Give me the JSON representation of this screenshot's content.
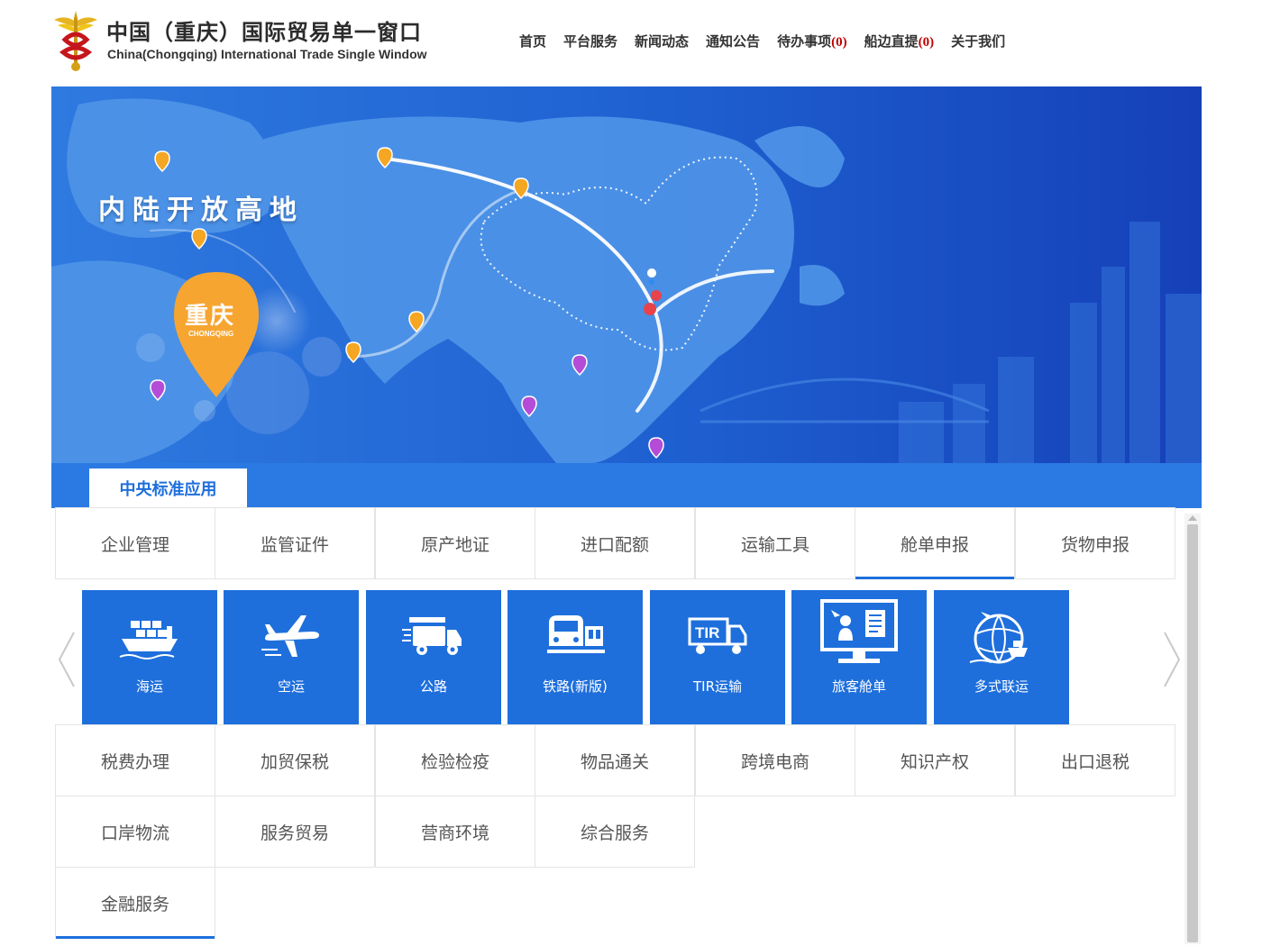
{
  "header": {
    "title_cn": "中国（重庆）国际贸易单一窗口",
    "title_en": "China(Chongqing) International Trade Single Window",
    "nav": [
      {
        "label": "首页"
      },
      {
        "label": "平台服务"
      },
      {
        "label": "新闻动态"
      },
      {
        "label": "通知公告"
      },
      {
        "label": "待办事项",
        "count": "(0)"
      },
      {
        "label": "船边直提",
        "count": "(0)"
      },
      {
        "label": "关于我们"
      }
    ]
  },
  "banner": {
    "slogan": "内陆开放高地",
    "city_cn": "重庆",
    "city_en": "CHONGQING"
  },
  "section_tab": "中央标准应用",
  "grid_rows": [
    [
      "企业管理",
      "监管证件",
      "原产地证",
      "进口配额",
      "运输工具",
      "舱单申报",
      "货物申报"
    ],
    [
      "税费办理",
      "加贸保税",
      "检验检疫",
      "物品通关",
      "跨境电商",
      "知识产权",
      "出口退税"
    ],
    [
      "口岸物流",
      "服务贸易",
      "营商环境",
      "综合服务"
    ],
    [
      "金融服务"
    ]
  ],
  "active_category": "舱单申报",
  "sub_tiles": [
    {
      "label": "海运",
      "icon": "ship-icon"
    },
    {
      "label": "空运",
      "icon": "airplane-icon"
    },
    {
      "label": "公路",
      "icon": "truck-icon"
    },
    {
      "label": "铁路(新版)",
      "icon": "train-icon"
    },
    {
      "label": "TIR运输",
      "icon": "tir-truck-icon",
      "icon_text": "TIR"
    },
    {
      "label": "旅客舱单",
      "icon": "passenger-monitor-icon"
    },
    {
      "label": "多式联运",
      "icon": "multimodal-globe-icon"
    }
  ],
  "colors": {
    "primary": "#1e6fdc",
    "section_bar": "#2b7ae4",
    "banner_bg": "#1c56c9",
    "pin_orange": "#f5a623",
    "pin_purple": "#b44cd8",
    "count_red": "#c00000"
  }
}
